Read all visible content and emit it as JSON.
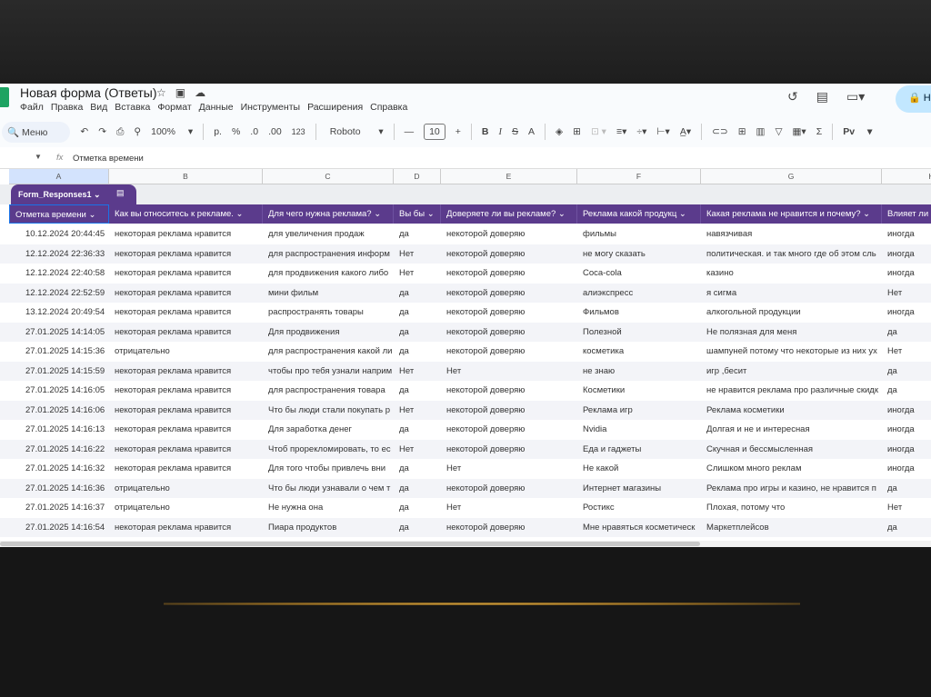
{
  "app": {
    "title": "Новая форма (Ответы)",
    "share_label": "Н"
  },
  "menu": [
    "Файл",
    "Правка",
    "Вид",
    "Вставка",
    "Формат",
    "Данные",
    "Инструменты",
    "Расширения",
    "Справка"
  ],
  "toolbar": {
    "search": "Меню",
    "zoom": "100%",
    "currency": "р.",
    "percent": "%",
    "dec_less": ".0",
    "dec_more": ".00",
    "number_format": "123",
    "font": "Roboto",
    "font_size": "10",
    "bold": "B",
    "italic": "I",
    "strike": "S",
    "text_color": "A",
    "sum": "Σ",
    "input_tools": "Pv"
  },
  "formula": {
    "fx": "fx",
    "value": "Отметка времени"
  },
  "columns": [
    "A",
    "B",
    "C",
    "D",
    "E",
    "F",
    "G",
    "H"
  ],
  "sheet_tab": "Form_Responses1",
  "headers": [
    "Отметка времени",
    "Как вы относитесь к рекламе.",
    "Для чего нужна реклама?",
    "Вы бы",
    "Доверяете ли вы рекламе?",
    "Реклама какой продукц",
    "Какая реклама не нравится и почему?",
    "Влияет ли"
  ],
  "rows": [
    [
      "10.12.2024 20:44:45",
      "некоторая реклама нравится",
      "для увеличения продаж",
      "да",
      "некоторой доверяю",
      "фильмы",
      "навязчивая",
      "иногда"
    ],
    [
      "12.12.2024 22:36:33",
      "некоторая реклама нравится",
      "для распространения информ",
      "Нет",
      "некоторой доверяю",
      "не могу сказать",
      "политическая. и так много где об этом сль",
      "иногда"
    ],
    [
      "12.12.2024 22:40:58",
      "некоторая реклама нравится",
      "для продвижения  какого либо",
      "Нет",
      "некоторой доверяю",
      "Coca-cola",
      "казино",
      "иногда"
    ],
    [
      "12.12.2024 22:52:59",
      "некоторая реклама нравится",
      "мини фильм",
      "да",
      "некоторой доверяю",
      "алиэкспресс",
      "я сигма",
      "Нет"
    ],
    [
      "13.12.2024 20:49:54",
      "некоторая реклама нравится",
      "распространять товары",
      "да",
      "некоторой доверяю",
      " Фильмов",
      "алкогольной  продукции",
      "иногда"
    ],
    [
      "27.01.2025 14:14:05",
      "некоторая реклама нравится",
      "Для продвижения",
      "да",
      "некоторой доверяю",
      "Полезной",
      "Не полязная для меня",
      "да"
    ],
    [
      "27.01.2025 14:15:36",
      "отрицательно",
      "для распространения какой ли",
      "да",
      "некоторой доверяю",
      "косметика",
      "шампуней потому что некоторые из них ух",
      "Нет"
    ],
    [
      "27.01.2025 14:15:59",
      "некоторая реклама нравится",
      "чтобы про тебя узнали наприм",
      "Нет",
      "Нет",
      "не знаю",
      "игр ,бесит",
      "да"
    ],
    [
      "27.01.2025 14:16:05",
      "некоторая реклама нравится",
      "для распространения товара",
      "да",
      "некоторой доверяю",
      "Косметики",
      "не нравится реклама про различные скидк",
      "да"
    ],
    [
      "27.01.2025 14:16:06",
      "некоторая реклама нравится",
      "Что бы люди стали покупать р",
      "Нет",
      "некоторой доверяю",
      "Реклама игр",
      "Реклама косметики",
      "иногда"
    ],
    [
      "27.01.2025 14:16:13",
      "некоторая реклама нравится",
      "Для заработка денег",
      "да",
      "некоторой доверяю",
      "Nvidia",
      "Долгая и не и интересная",
      "иногда"
    ],
    [
      "27.01.2025 14:16:22",
      "некоторая реклама нравится",
      "Чтоб прорекломировать, то ес",
      "Нет",
      "некоторой доверяю",
      "Еда и гаджеты",
      "Скучная и бессмысленная",
      "иногда"
    ],
    [
      "27.01.2025 14:16:32",
      "некоторая реклама нравится",
      "Для того чтобы привлечь вни",
      "да",
      "Нет",
      "Не какой",
      "Слишком много реклам",
      "иногда"
    ],
    [
      "27.01.2025 14:16:36",
      "отрицательно",
      "Что бы люди узнавали о чем т",
      "да",
      "некоторой доверяю",
      "Интернет магазины",
      "Реклама про игры и казино, не нравится п",
      "да"
    ],
    [
      "27.01.2025 14:16:37",
      "отрицательно",
      "Не нужна она",
      "да",
      "Нет",
      "Ростикс",
      "Плохая, потому что",
      "Нет"
    ],
    [
      "27.01.2025 14:16:54",
      "некоторая реклама нравится",
      "Пиара продуктов",
      "да",
      "некоторой доверяю",
      "Мне нравяться косметическ",
      "Маркетплейсов",
      "да"
    ]
  ],
  "colors": {
    "header": "#5b3b8c",
    "stripe": "#f3f4f8"
  }
}
